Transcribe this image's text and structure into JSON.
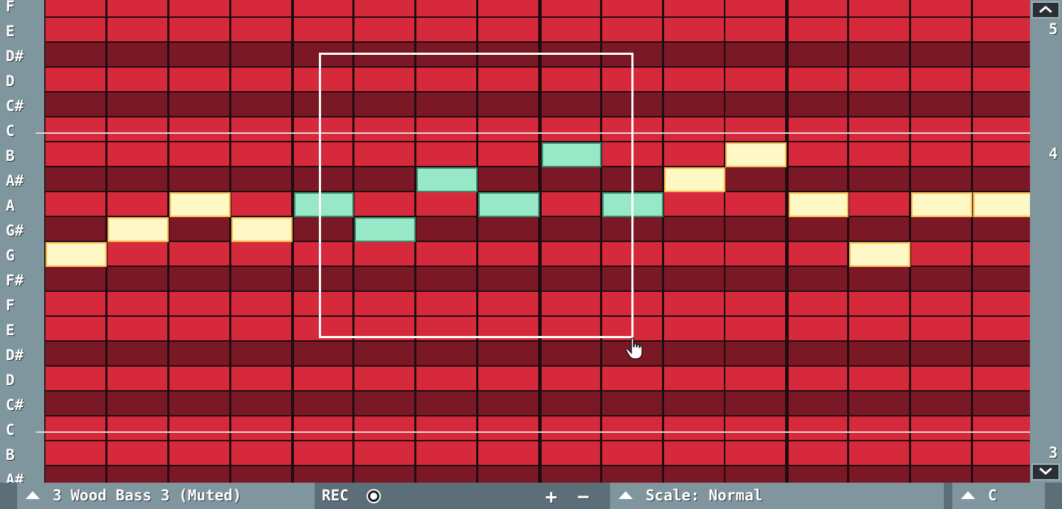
{
  "piano_roll": {
    "key_labels": [
      "F",
      "E",
      "D#",
      "D",
      "C#",
      "C",
      "B",
      "A#",
      "A",
      "G#",
      "G",
      "F#",
      "F",
      "E",
      "D#",
      "D",
      "C#",
      "C",
      "B",
      "A#"
    ],
    "black_keys": [
      false,
      false,
      true,
      false,
      true,
      false,
      false,
      true,
      false,
      true,
      false,
      true,
      false,
      false,
      true,
      false,
      true,
      false,
      false,
      true
    ],
    "steps": 16,
    "notes": [
      {
        "row": 10,
        "step": 0,
        "color": "cream"
      },
      {
        "row": 9,
        "step": 1,
        "color": "cream"
      },
      {
        "row": 8,
        "step": 2,
        "color": "cream"
      },
      {
        "row": 9,
        "step": 3,
        "color": "cream"
      },
      {
        "row": 8,
        "step": 4,
        "color": "mint"
      },
      {
        "row": 9,
        "step": 5,
        "color": "mint"
      },
      {
        "row": 7,
        "step": 6,
        "color": "mint"
      },
      {
        "row": 8,
        "step": 7,
        "color": "mint"
      },
      {
        "row": 6,
        "step": 8,
        "color": "mint"
      },
      {
        "row": 8,
        "step": 9,
        "color": "mint"
      },
      {
        "row": 7,
        "step": 10,
        "color": "cream"
      },
      {
        "row": 6,
        "step": 11,
        "color": "cream"
      },
      {
        "row": 8,
        "step": 12,
        "color": "cream"
      },
      {
        "row": 10,
        "step": 13,
        "color": "cream"
      },
      {
        "row": 8,
        "step": 14,
        "color": "cream"
      },
      {
        "row": 8,
        "step": 15,
        "color": "cream"
      }
    ],
    "octave_numbers": [
      {
        "label": "5",
        "row": 1
      },
      {
        "label": "4",
        "row": 6
      },
      {
        "label": "3",
        "row": 18
      }
    ]
  },
  "scrollbar": {
    "up_icon": "chevron-up-icon",
    "down_icon": "chevron-down-icon"
  },
  "bottom_bar": {
    "instrument": "3 Wood Bass 3 (Muted)",
    "rec_label": "REC",
    "plus_label": "+",
    "minus_label": "−",
    "scale_label": "Scale: Normal",
    "key_label": "C"
  },
  "colors": {
    "white_key_row": "#d62a3c",
    "black_key_row": "#7a1826",
    "note_cream": "#fdf8c6",
    "note_mint": "#96e8c6",
    "selection": "#ffffff"
  }
}
